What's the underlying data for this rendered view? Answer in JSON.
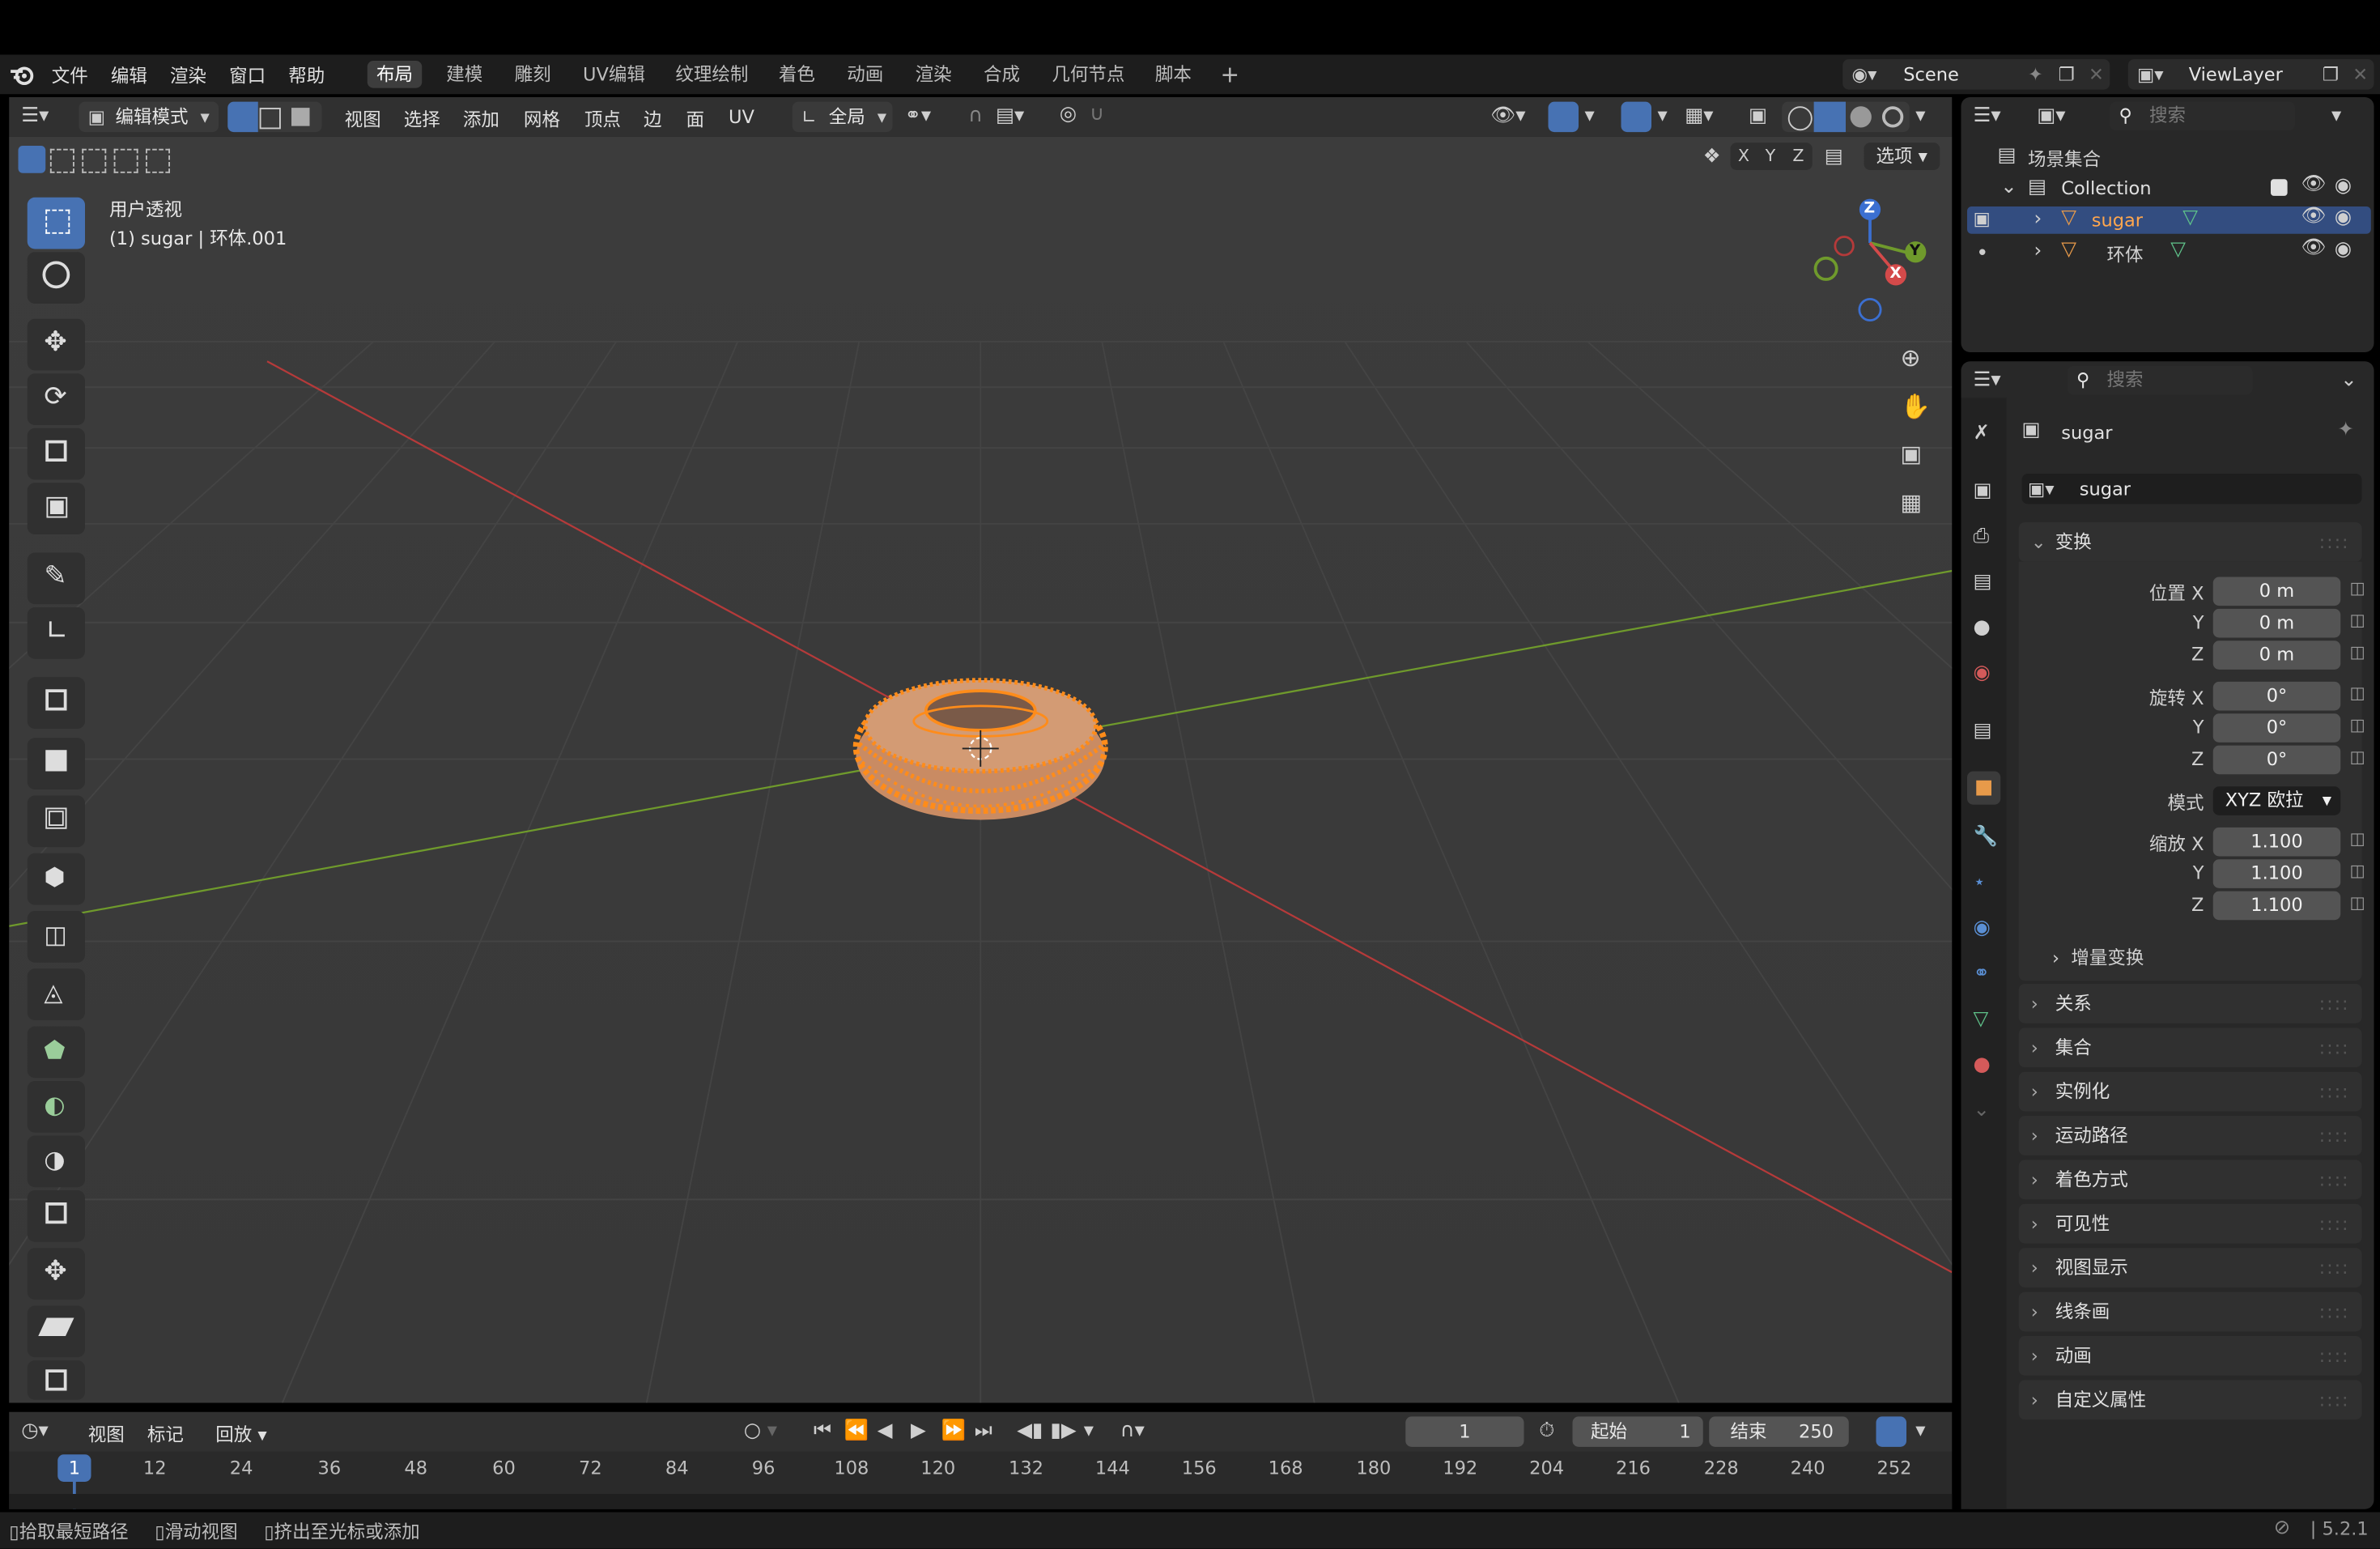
{
  "menu": {
    "items": [
      "文件",
      "编辑",
      "渲染",
      "窗口",
      "帮助"
    ]
  },
  "workspaces": [
    "布局",
    "建模",
    "雕刻",
    "UV编辑",
    "纹理绘制",
    "着色",
    "动画",
    "渲染",
    "合成",
    "几何节点",
    "脚本"
  ],
  "workspace_active": "布局",
  "scene": {
    "name": "Scene",
    "view_layer": "ViewLayer"
  },
  "viewport_header": {
    "mode": "编辑模式",
    "menus": [
      "视图",
      "选择",
      "添加",
      "网格",
      "顶点",
      "边",
      "面",
      "UV"
    ],
    "transform_orientation": "全局",
    "axes": [
      "X",
      "Y",
      "Z"
    ],
    "options": "选项"
  },
  "viewport": {
    "view_name": "用户透视",
    "object_info": "(1) sugar | 环体.001"
  },
  "gizmo": {
    "x": "X",
    "y": "Y",
    "z": "Z"
  },
  "outliner": {
    "search_placeholder": "搜索",
    "scene_collection": "场景集合",
    "collection": "Collection",
    "objects": [
      {
        "name": "sugar",
        "selected": true
      },
      {
        "name": "环体",
        "selected": false
      }
    ]
  },
  "properties": {
    "search_placeholder": "搜索",
    "object_name": "sugar",
    "data_name": "sugar",
    "transform": {
      "title": "变换",
      "location_label": "位置 X",
      "location": [
        "0 m",
        "0 m",
        "0 m"
      ],
      "rotation_label": "旋转 X",
      "rotation": [
        "0°",
        "0°",
        "0°"
      ],
      "mode_label": "模式",
      "mode_value": "XYZ 欧拉",
      "scale_label": "缩放 X",
      "scale": [
        "1.100",
        "1.100",
        "1.100"
      ],
      "axis_y": "Y",
      "axis_z": "Z",
      "delta": "增量变换"
    },
    "panels": [
      "关系",
      "集合",
      "实例化",
      "运动路径",
      "着色方式",
      "可见性",
      "视图显示",
      "线条画",
      "动画",
      "自定义属性"
    ]
  },
  "timeline": {
    "menus": [
      "视图",
      "标记"
    ],
    "playback": "回放",
    "current_frame": "1",
    "start_label": "起始",
    "start": "1",
    "end_label": "结束",
    "end": "250",
    "ticks": [
      "1",
      "12",
      "24",
      "36",
      "48",
      "60",
      "72",
      "84",
      "96",
      "108",
      "120",
      "132",
      "144",
      "156",
      "168",
      "180",
      "192",
      "204",
      "216",
      "228",
      "240",
      "252"
    ]
  },
  "status": {
    "hints": [
      "拾取最短路径",
      "滑动视图",
      "挤出至光标或添加"
    ],
    "version": "5.2.1"
  },
  "colors": {
    "accent": "#4772b3",
    "selection": "#ff8c1a",
    "x_axis": "#b53a3a",
    "y_axis": "#6f9a2c"
  }
}
